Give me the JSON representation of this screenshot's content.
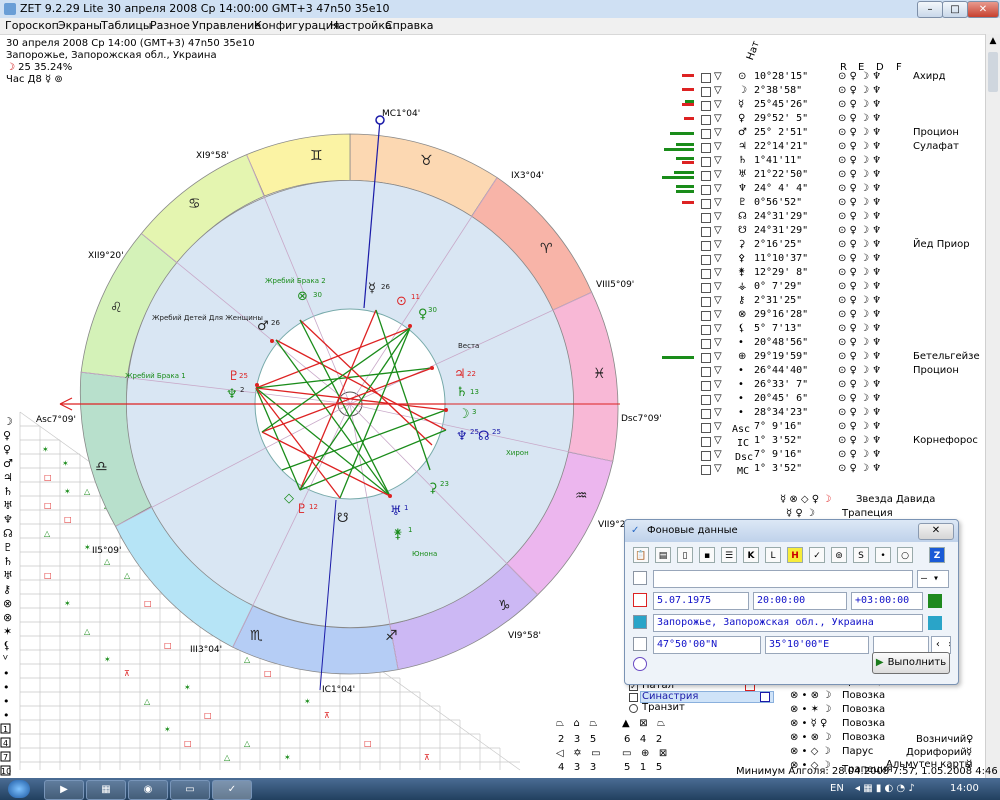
{
  "window": {
    "title": "ZET 9.2.29 Lite    30 апреля 2008  Ср  14:00:00 GMT+3 47n50  35e10"
  },
  "menu": [
    "Гороскоп",
    "Экраны",
    "Таблицы",
    "Разное",
    "Управление",
    "Конфигурация",
    "Настройка",
    "Справка"
  ],
  "info": {
    "line1": "30 апреля 2008  Ср  14:00 (GMT+3) 47n50  35e10",
    "line2": "Запорожье, Запорожская обл., Украина",
    "line3": "25 35.24%",
    "line4": "Час Д8"
  },
  "chart": {
    "houses": {
      "mc": "MC1°04'",
      "ix": "IX3°04'",
      "viii": "VIII5°09'",
      "dsc": "Dsc7°09'",
      "vii": "VII9°20'",
      "vi": "VI9°58'",
      "ic": "IC1°04'",
      "iii": "III3°04'",
      "ii": "II5°09'",
      "asc": "Asc7°09'",
      "xii": "XII9°20'",
      "xi": "XI9°58'"
    },
    "labels": {
      "lot_marriage_2": "Жребий Брака 2",
      "lot_children": "Жребий Детей Для Женщины",
      "lot_marriage_1": "Жребий Брака 1",
      "vesta": "Веста",
      "chiron": "Хирон",
      "juno": "Юнона"
    },
    "degrees": {
      "d26a": "26",
      "d30a": "30",
      "d11": "11",
      "d30b": "30",
      "d26b": "26",
      "d25a": "25",
      "d2": "2",
      "d22": "22",
      "d13": "13",
      "d3": "3",
      "d25b": "25",
      "d25c": "25",
      "d23": "23",
      "d12": "12",
      "d1": "1",
      "d1b": "1"
    }
  },
  "right_table": {
    "header": {
      "nat": "Нат",
      "r": "R",
      "e": "E",
      "d": "D",
      "f": "F"
    },
    "rows": [
      {
        "pos": "10°28'15\"",
        "star": "Ахирд"
      },
      {
        "pos": "2°38'58\"",
        "star": ""
      },
      {
        "pos": "25°45'26\"",
        "star": ""
      },
      {
        "pos": "29°52' 5\"",
        "star": ""
      },
      {
        "pos": "25° 2'51\"",
        "star": "Процион"
      },
      {
        "pos": "22°14'21\"",
        "star": "Сулафат"
      },
      {
        "pos": "1°41'11\"",
        "star": ""
      },
      {
        "pos": "21°22'50\"",
        "star": ""
      },
      {
        "pos": "24° 4' 4\"",
        "star": ""
      },
      {
        "pos": "0°56'52\"",
        "star": ""
      },
      {
        "pos": "24°31'29\"",
        "star": ""
      },
      {
        "pos": "24°31'29\"",
        "star": ""
      },
      {
        "pos": "2°16'25\"",
        "star": "Йед Приор"
      },
      {
        "pos": "11°10'37\"",
        "star": ""
      },
      {
        "pos": "12°29' 8\"",
        "star": ""
      },
      {
        "pos": "0° 7'29\"",
        "star": ""
      },
      {
        "pos": "2°31'25\"",
        "star": ""
      },
      {
        "pos": "29°16'28\"",
        "star": ""
      },
      {
        "pos": "5° 7'13\"",
        "star": ""
      },
      {
        "pos": "20°48'56\"",
        "star": ""
      },
      {
        "pos": "29°19'59\"",
        "star": "Бетельгейзе"
      },
      {
        "pos": "26°44'40\"",
        "star": "Процион"
      },
      {
        "pos": "26°33' 7\"",
        "star": ""
      },
      {
        "pos": "20°45' 6\"",
        "star": ""
      },
      {
        "pos": "28°34'23\"",
        "star": ""
      },
      {
        "pos": "7° 9'16\"",
        "star": ""
      },
      {
        "pos": "1° 3'52\"",
        "star": "Корнефорос"
      },
      {
        "pos": "7° 9'16\"",
        "star": ""
      },
      {
        "pos": "1° 3'52\"",
        "star": ""
      }
    ],
    "points": [
      "Asc",
      "IC",
      "Dsc",
      "MC"
    ],
    "figures": [
      "Звезда Давида",
      "Трапеция"
    ],
    "lower_figures": [
      "Повозка",
      "Повозка",
      "Повозка",
      "Повозка",
      "Парус",
      "Трапеция"
    ],
    "bottom": [
      "Возничий",
      "Дорифорий",
      "Альмутен карты"
    ]
  },
  "dialog": {
    "title": "Фоновые данные",
    "date": "5.07.1975",
    "time": "20:00:00",
    "tz": "+03:00:00",
    "place": "Запорожье, Запорожская обл., Украина",
    "lat": "47°50'00\"N",
    "lon": "35°10'00\"E",
    "run": "Выполнить"
  },
  "layers": [
    {
      "label": "Натал",
      "checked": true
    },
    {
      "label": "Синастрия",
      "checked": false
    },
    {
      "label": "Транзит",
      "checked": false
    }
  ],
  "counts": {
    "row1": [
      "2",
      "3",
      "5"
    ],
    "row2": [
      "6",
      "4",
      "2"
    ],
    "row3": [
      "4",
      "3",
      "3"
    ],
    "row4": [
      "5",
      "1",
      "5"
    ]
  },
  "status": {
    "text": "Минимум Алголя: 28.04.2008 7:57, 1.05.2008  4:46",
    "lang": "EN",
    "time": "14:00"
  },
  "colors": {
    "zodiac": [
      "#f6b2d8",
      "#dbb6f3",
      "#b7ccf5",
      "#b9e7f4",
      "#c4ecd6",
      "#b5dfc7",
      "#e5f6b7",
      "#faf5a8",
      "#fbd9aa",
      "#fbc1a6",
      "#f7a7a9",
      "#f6b2d8"
    ],
    "harmonic": "#1a8c1a",
    "tense": "#dd2222"
  }
}
